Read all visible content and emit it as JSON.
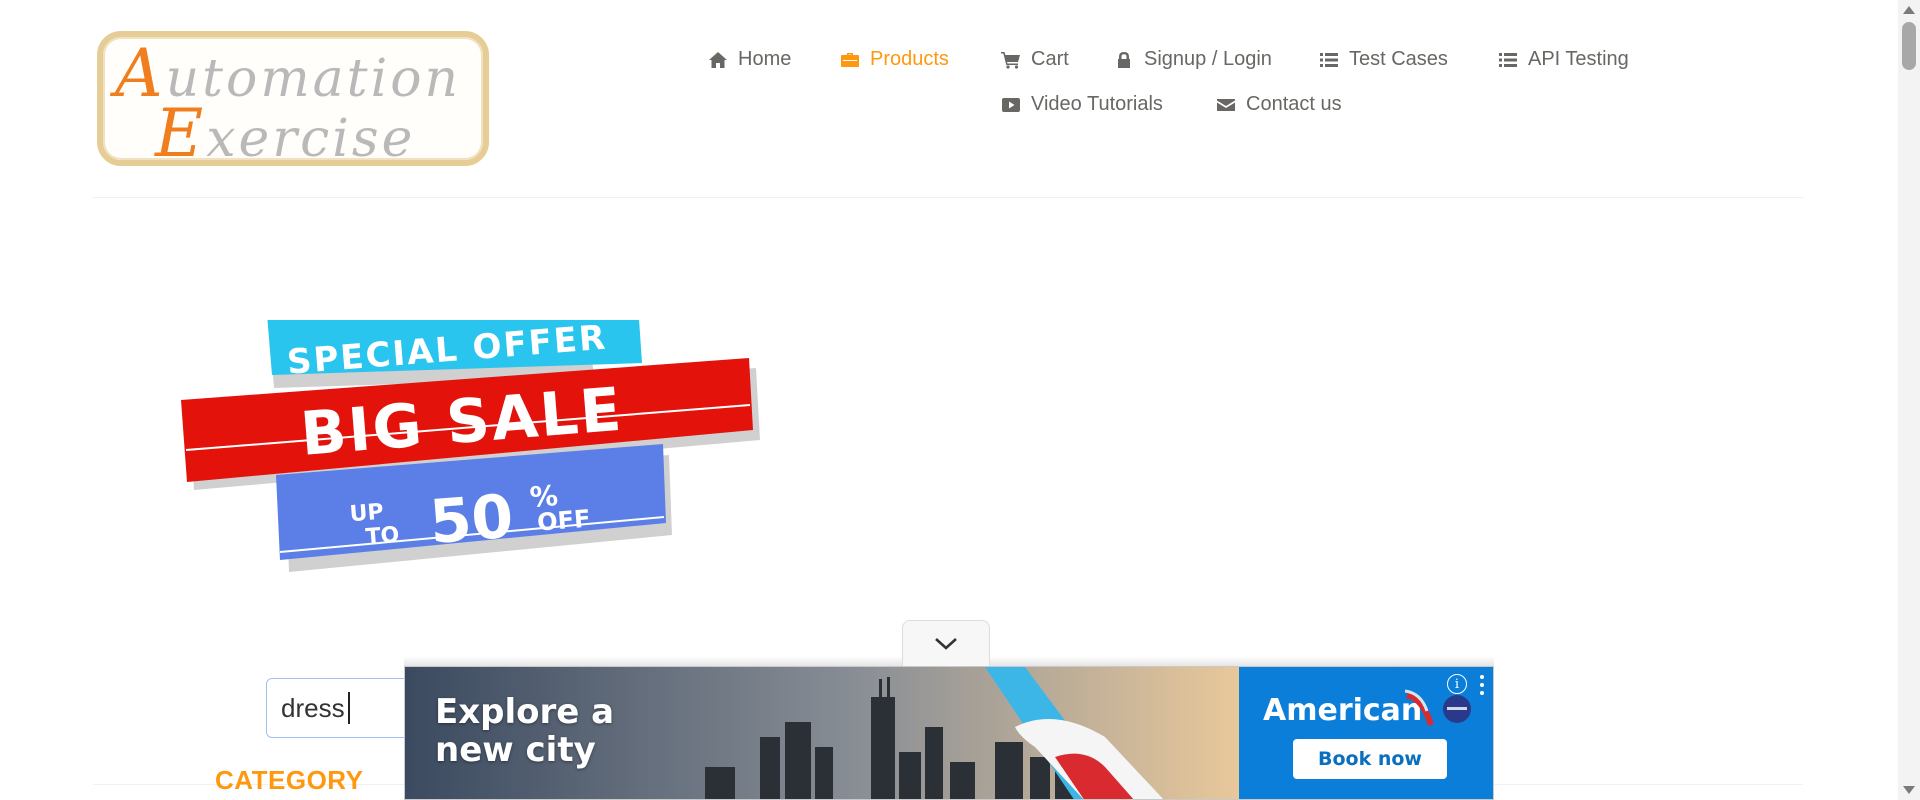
{
  "logo": {
    "line1_cap": "A",
    "line1_rest": "utomation",
    "line2_cap": "E",
    "line2_rest": "xercise"
  },
  "nav": {
    "items": [
      {
        "label": "Home",
        "icon": "home-icon"
      },
      {
        "label": "Products",
        "icon": "briefcase-icon",
        "active": true
      },
      {
        "label": "Cart",
        "icon": "cart-icon"
      },
      {
        "label": "Signup / Login",
        "icon": "lock-icon"
      },
      {
        "label": "Test Cases",
        "icon": "list-icon"
      },
      {
        "label": "API Testing",
        "icon": "list-icon"
      },
      {
        "label": "Video Tutorials",
        "icon": "youtube-play-icon"
      },
      {
        "label": "Contact us",
        "icon": "envelope-icon"
      }
    ]
  },
  "promo": {
    "line1": "SPECIAL OFFER",
    "line2": "BIG SALE",
    "up": "UP",
    "to": "TO",
    "percent": "50",
    "percent_sign": "%",
    "off": "OFF"
  },
  "search": {
    "value": "dress"
  },
  "sidebar": {
    "category_title": "CATEGORY"
  },
  "ad": {
    "headline": "Explore a\nnew city",
    "brand": "American",
    "cta": "Book now",
    "info": "i"
  },
  "colors": {
    "accent": "#fe980f",
    "text": "#696763",
    "ad_blue": "#0a7ed9"
  }
}
